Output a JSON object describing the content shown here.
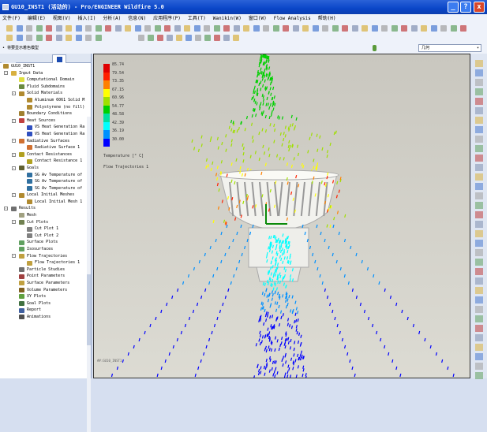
{
  "window": {
    "title": "GU10_INST1 (活动的) - Pro/ENGINEER Wildfire 5.0",
    "min": "_",
    "help": "?",
    "close": "x"
  },
  "menu": [
    "文件(F)",
    "编辑(E)",
    "视图(V)",
    "插入(I)",
    "分析(A)",
    "信息(N)",
    "应用程序(P)",
    "工具(T)",
    "Wanikin(W)",
    "窗口(W)",
    "Flow Analysis",
    "帮助(H)"
  ],
  "status": {
    "message": "• 将要显示着色模型",
    "filter": "几何"
  },
  "tree": [
    {
      "label": "GU10_INST1",
      "level": 0,
      "exp": "",
      "color": "#b08a30"
    },
    {
      "label": "Input Data",
      "level": 1,
      "exp": "-",
      "color": "#d8b040"
    },
    {
      "label": "Computational Domain",
      "level": 2,
      "exp": "",
      "color": "#e0e040"
    },
    {
      "label": "Fluid Subdomains",
      "level": 2,
      "exp": "",
      "color": "#6a8a40"
    },
    {
      "label": "Solid Materials",
      "level": 2,
      "exp": "-",
      "color": "#b08a30"
    },
    {
      "label": "Aluminum 6061 Solid M",
      "level": 3,
      "exp": "",
      "color": "#b08a30"
    },
    {
      "label": "Polystyrene (no fill)",
      "level": 3,
      "exp": "",
      "color": "#b08a30"
    },
    {
      "label": "Boundary Conditions",
      "level": 2,
      "exp": "",
      "color": "#a08030"
    },
    {
      "label": "Heat Sources",
      "level": 2,
      "exp": "-",
      "color": "#c04040"
    },
    {
      "label": "VS Heat Generation Ra",
      "level": 3,
      "exp": "",
      "color": "#3050c0"
    },
    {
      "label": "VS Heat Generation Ra",
      "level": 3,
      "exp": "",
      "color": "#3050c0"
    },
    {
      "label": "Radiative Surfaces",
      "level": 2,
      "exp": "-",
      "color": "#d07030"
    },
    {
      "label": "Radiative Surface 1",
      "level": 3,
      "exp": "",
      "color": "#d07030"
    },
    {
      "label": "Contact Resistances",
      "level": 2,
      "exp": "-",
      "color": "#b0a020"
    },
    {
      "label": "Contact Resistance 1",
      "level": 3,
      "exp": "",
      "color": "#b0a020"
    },
    {
      "label": "Goals",
      "level": 2,
      "exp": "-",
      "color": "#606030"
    },
    {
      "label": "SG Av Temperature of",
      "level": 3,
      "exp": "",
      "color": "#3070a0"
    },
    {
      "label": "SG Av Temperature of",
      "level": 3,
      "exp": "",
      "color": "#3070a0"
    },
    {
      "label": "SG Av Temperature of",
      "level": 3,
      "exp": "",
      "color": "#3070a0"
    },
    {
      "label": "Local Initial Meshes",
      "level": 2,
      "exp": "-",
      "color": "#b08a30"
    },
    {
      "label": "Local Initial Mesh 1",
      "level": 3,
      "exp": "",
      "color": "#b08a30"
    },
    {
      "label": "Results",
      "level": 1,
      "exp": "-",
      "color": "#707070"
    },
    {
      "label": "Mesh",
      "level": 2,
      "exp": "",
      "color": "#a0a080"
    },
    {
      "label": "Cut Plots",
      "level": 2,
      "exp": "-",
      "color": "#708050"
    },
    {
      "label": "Cut Plot 1",
      "level": 3,
      "exp": "",
      "color": "#808080"
    },
    {
      "label": "Cut Plot 2",
      "level": 3,
      "exp": "",
      "color": "#808080"
    },
    {
      "label": "Surface Plots",
      "level": 2,
      "exp": "",
      "color": "#60a060"
    },
    {
      "label": "Isosurfaces",
      "level": 2,
      "exp": "",
      "color": "#60a060"
    },
    {
      "label": "Flow Trajectories",
      "level": 2,
      "exp": "-",
      "color": "#c0a040"
    },
    {
      "label": "Flow Trajectories 1",
      "level": 3,
      "exp": "",
      "color": "#c0a040"
    },
    {
      "label": "Particle Studies",
      "level": 2,
      "exp": "",
      "color": "#707070"
    },
    {
      "label": "Point Parameters",
      "level": 2,
      "exp": "",
      "color": "#a04040"
    },
    {
      "label": "Surface Parameters",
      "level": 2,
      "exp": "",
      "color": "#c0a040"
    },
    {
      "label": "Volume Parameters",
      "level": 2,
      "exp": "",
      "color": "#806020"
    },
    {
      "label": "XY Plots",
      "level": 2,
      "exp": "",
      "color": "#60a040"
    },
    {
      "label": "Goal Plots",
      "level": 2,
      "exp": "",
      "color": "#407040"
    },
    {
      "label": "Report",
      "level": 2,
      "exp": "",
      "color": "#4060a0"
    },
    {
      "label": "Animations",
      "level": 2,
      "exp": "",
      "color": "#505050"
    }
  ],
  "legend": {
    "values": [
      "85.74",
      "79.54",
      "73.35",
      "67.15",
      "60.96",
      "54.77",
      "48.58",
      "42.39",
      "36.19",
      "30.00"
    ],
    "colors": [
      "#e00000",
      "#ff2000",
      "#ff8000",
      "#ffff00",
      "#a0e000",
      "#00d000",
      "#00e0a0",
      "#00ffff",
      "#0090ff",
      "#0000ff"
    ],
    "title": "Temperature [° C]",
    "subtitle": "Flow Trajectories 1"
  },
  "view": {
    "model_label": "##:GU10_INST1"
  }
}
